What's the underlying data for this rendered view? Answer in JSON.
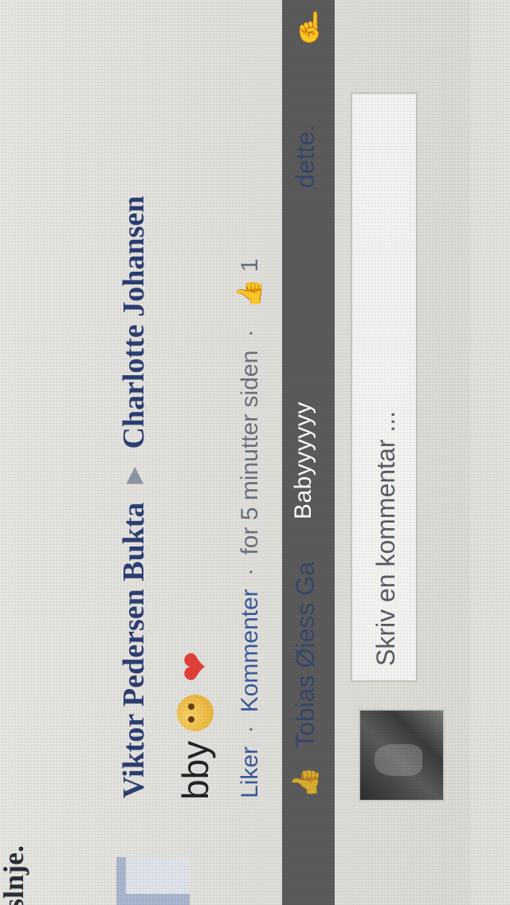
{
  "partial_text": "slnje.",
  "post": {
    "author": "Viktor Pedersen Bukta",
    "arrow": "▶",
    "recipient": "Charlotte Johansen",
    "message": "bby",
    "actions": {
      "like": "Liker",
      "comment": "Kommenter",
      "timestamp": "for 5 minutter siden",
      "likes_count_icon": "thumbs-up-icon",
      "likes_count": "1"
    }
  },
  "likes_line": {
    "text": "Tobias Øiess Ga",
    "suffix": "dette."
  },
  "overlay_caption": "Babyyyyyy",
  "comment_box": {
    "placeholder": "Skriv en kommentar ..."
  },
  "colors": {
    "link": "#2c3f72",
    "band": "#5b5b5b",
    "background": "#e3e1dc"
  }
}
